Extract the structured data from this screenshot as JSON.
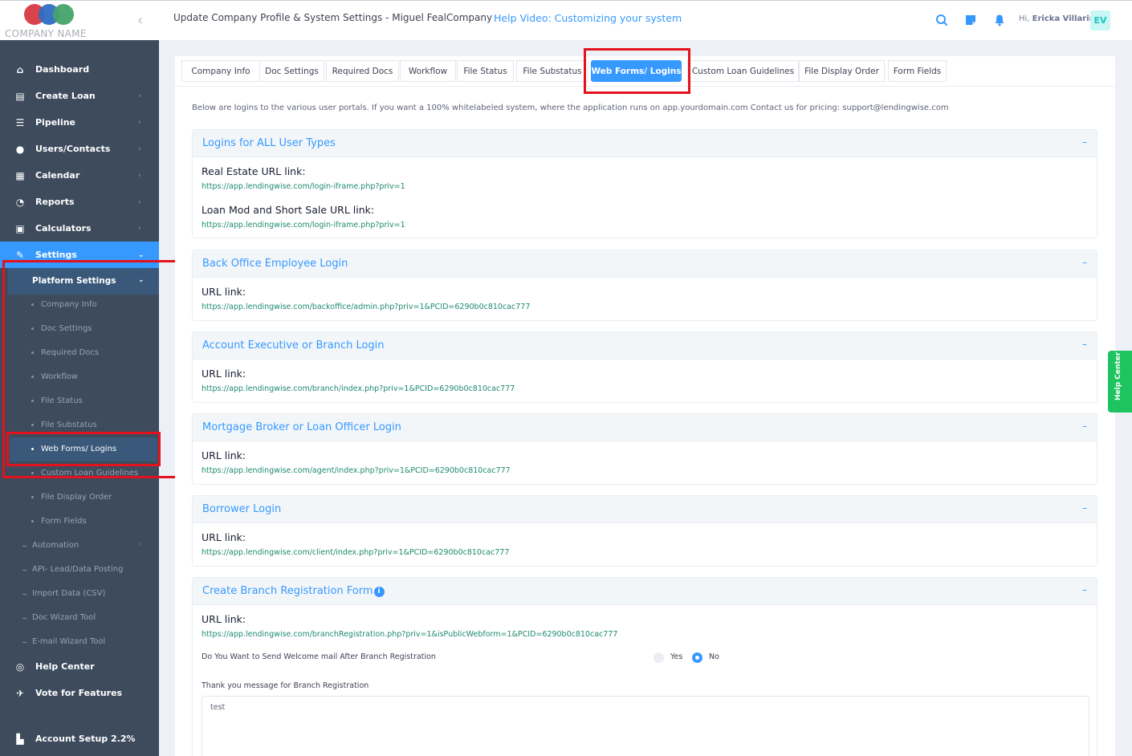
{
  "brand": {
    "company_name": "COMPANY NAME"
  },
  "header": {
    "title": "Update Company Profile & System Settings - Miguel FealCompany",
    "help_video": "Help Video: Customizing your system",
    "greeting_prefix": "Hi,",
    "user_name": "Ericka Villarin",
    "avatar_initials": "EV"
  },
  "sidebar": {
    "items": [
      {
        "label": "Dashboard",
        "icon": "home-icon"
      },
      {
        "label": "Create Loan",
        "icon": "file-icon"
      },
      {
        "label": "Pipeline",
        "icon": "list-icon"
      },
      {
        "label": "Users/Contacts",
        "icon": "user-icon"
      },
      {
        "label": "Calendar",
        "icon": "calendar-icon"
      },
      {
        "label": "Reports",
        "icon": "chart-icon"
      },
      {
        "label": "Calculators",
        "icon": "calculator-icon"
      },
      {
        "label": "Settings",
        "icon": "wrench-icon"
      }
    ],
    "platform_settings": "Platform Settings",
    "platform_sub": [
      "Company Info",
      "Doc Settings",
      "Required Docs",
      "Workflow",
      "File Status",
      "File Substatus",
      "Web Forms/ Logins",
      "Custom Loan Guidelines",
      "File Display Order",
      "Form Fields"
    ],
    "settings_sub": [
      "Automation",
      "API- Lead/Data Posting",
      "Import Data (CSV)",
      "Doc Wizard Tool",
      "E-mail Wizard Tool"
    ],
    "bottom": [
      {
        "label": "Help Center",
        "icon": "help-circle-icon"
      },
      {
        "label": "Vote for Features",
        "icon": "rocket-icon"
      },
      {
        "label": "Account Setup 2.2%",
        "icon": "setup-icon"
      }
    ]
  },
  "tabs": [
    "Company Info",
    "Doc Settings",
    "Required Docs",
    "Workflow",
    "File Status",
    "File Substatus",
    "Web Forms/ Logins",
    "Custom Loan Guidelines",
    "File Display Order",
    "Form Fields"
  ],
  "active_tab": "Web Forms/ Logins",
  "intro": "Below are logins to the various user portals. If you want a 100% whitelabeled system, where the application runs on app.yourdomain.com Contact us for pricing: support@lendingwise.com",
  "sections": {
    "all_users": {
      "title": "Logins for ALL User Types",
      "real_estate_label": "Real Estate URL link:",
      "real_estate_url": "https://app.lendingwise.com/login-iframe.php?priv=1",
      "loan_mod_label": "Loan Mod and Short Sale URL link:",
      "loan_mod_url": "https://app.lendingwise.com/login-iframe.php?priv=1"
    },
    "back_office": {
      "title": "Back Office Employee Login",
      "label": "URL link:",
      "url": "https://app.lendingwise.com/backoffice/admin.php?priv=1&PCID=6290b0c810cac777"
    },
    "branch": {
      "title": "Account Executive or Branch Login",
      "label": "URL link:",
      "url": "https://app.lendingwise.com/branch/index.php?priv=1&PCID=6290b0c810cac777"
    },
    "broker": {
      "title": "Mortgage Broker or Loan Officer Login",
      "label": "URL link:",
      "url": "https://app.lendingwise.com/agent/index.php?priv=1&PCID=6290b0c810cac777"
    },
    "borrower": {
      "title": "Borrower Login",
      "label": "URL link:",
      "url": "https://app.lendingwise.com/client/index.php?priv=1&PCID=6290b0c810cac777"
    },
    "branch_reg": {
      "title": "Create Branch Registration Form",
      "label": "URL link:",
      "url": "https://app.lendingwise.com/branchRegistration.php?priv=1&isPublicWebform=1&PCID=6290b0c810cac777",
      "question": "Do You Want to Send Welcome mail After Branch Registration",
      "yes": "Yes",
      "no": "No",
      "selected": "No",
      "thanks_label": "Thank you message for Branch Registration",
      "thanks_value": "test"
    }
  },
  "toggle_symbol": "–",
  "help_center_tab": "Help Center",
  "colors": {
    "accent": "#3699ff",
    "sidebar": "#3d4b5d",
    "highlight": "#e4121c",
    "help_center": "#1ec45f"
  }
}
